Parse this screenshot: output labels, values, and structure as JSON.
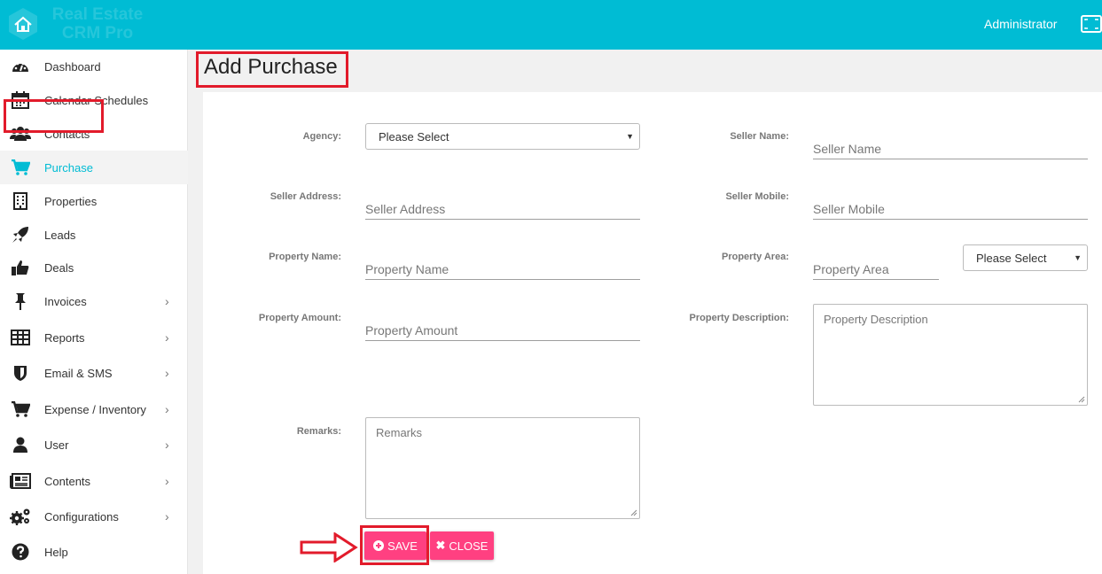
{
  "header": {
    "logo_line1": "Real Estate",
    "logo_line2": "CRM Pro",
    "user": "Administrator",
    "brand_color": "#00bcd4"
  },
  "sidebar": {
    "items": [
      {
        "label": "Dashboard",
        "icon": "dashboard-icon",
        "submenu": false
      },
      {
        "label": "Calendar Schedules",
        "icon": "calendar-icon",
        "submenu": false
      },
      {
        "label": "Contacts",
        "icon": "users-icon",
        "submenu": false
      },
      {
        "label": "Purchase",
        "icon": "cart-icon",
        "submenu": false,
        "active": true
      },
      {
        "label": "Properties",
        "icon": "building-icon",
        "submenu": false
      },
      {
        "label": "Leads",
        "icon": "rocket-icon",
        "submenu": false
      },
      {
        "label": "Deals",
        "icon": "thumbs-up-icon",
        "submenu": false
      },
      {
        "label": "Invoices",
        "icon": "pin-icon",
        "submenu": true
      },
      {
        "label": "Reports",
        "icon": "table-icon",
        "submenu": true
      },
      {
        "label": "Email & SMS",
        "icon": "shield-icon",
        "submenu": true
      },
      {
        "label": "Expense / Inventory",
        "icon": "cart-icon",
        "submenu": true
      },
      {
        "label": "User",
        "icon": "user-icon",
        "submenu": true
      },
      {
        "label": "Contents",
        "icon": "newspaper-icon",
        "submenu": true
      },
      {
        "label": "Configurations",
        "icon": "cogs-icon",
        "submenu": true
      },
      {
        "label": "Help",
        "icon": "question-icon",
        "submenu": false
      }
    ]
  },
  "page": {
    "title": "Add Purchase"
  },
  "form": {
    "agency_label": "Agency:",
    "agency_value": "Please Select",
    "seller_name_label": "Seller Name:",
    "seller_name_placeholder": "Seller Name",
    "seller_address_label": "Seller Address:",
    "seller_address_placeholder": "Seller Address",
    "seller_mobile_label": "Seller Mobile:",
    "seller_mobile_placeholder": "Seller Mobile",
    "property_name_label": "Property Name:",
    "property_name_placeholder": "Property Name",
    "property_area_label": "Property Area:",
    "property_area_placeholder": "Property Area",
    "property_area_unit_value": "Please Select",
    "property_amount_label": "Property Amount:",
    "property_amount_placeholder": "Property Amount",
    "property_description_label": "Property Description:",
    "property_description_placeholder": "Property Description",
    "remarks_label": "Remarks:",
    "remarks_placeholder": "Remarks",
    "save_label": "SAVE",
    "close_label": "CLOSE",
    "button_color": "#ff4081"
  },
  "annotation_color": "#e21b2b"
}
